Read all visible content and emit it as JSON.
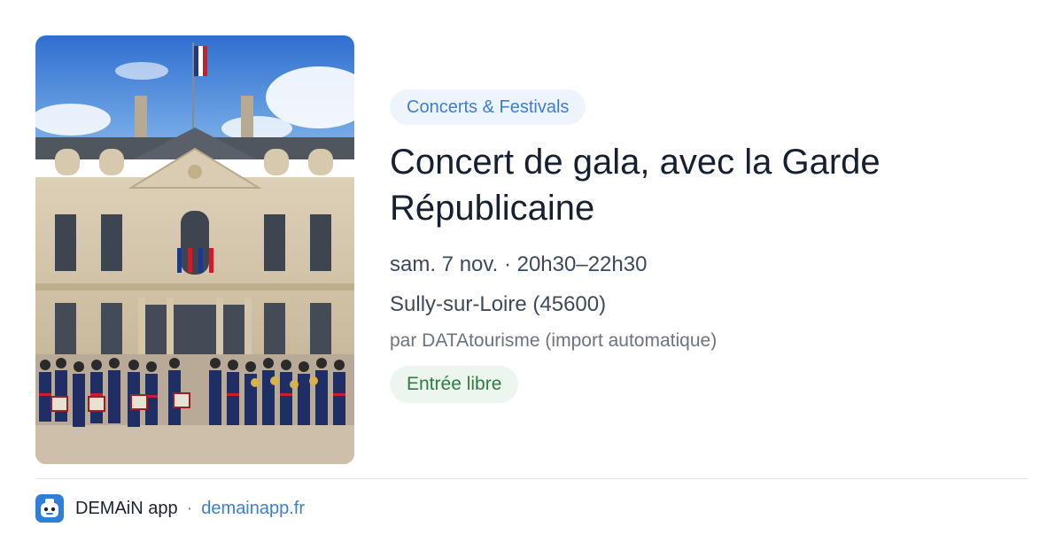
{
  "card": {
    "image_alt": "Garde Républicaine band in front of the Élysée Palace",
    "category": "Concerts & Festivals",
    "title": "Concert de gala, avec la Garde Républicaine",
    "datetime": "sam. 7 nov. · 20h30–22h30",
    "location": "Sully-sur-Loire (45600)",
    "source": "par DATAtourisme (import automatique)",
    "price": "Entrée libre"
  },
  "footer": {
    "app_name": "DEMAiN app",
    "separator": "·",
    "site": "demainapp.fr",
    "app_icon": "robot-face-icon"
  },
  "colors": {
    "accent": "#3f7fcf",
    "tag_bg": "#eef4fc",
    "price_green": "#2f7d43",
    "price_bg": "#ecf6ee",
    "title": "#16202f"
  }
}
